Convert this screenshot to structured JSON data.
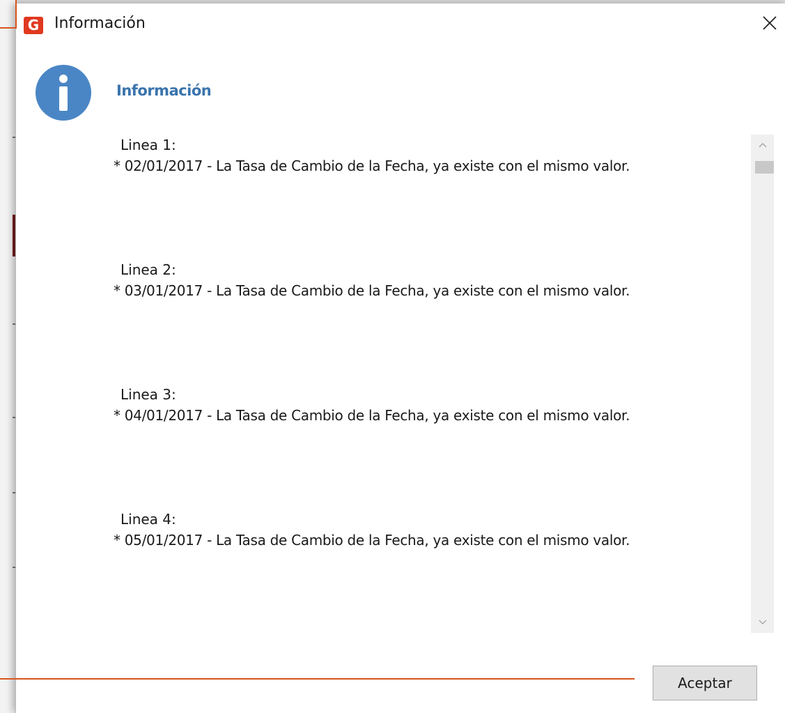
{
  "window": {
    "title": "Información",
    "app_icon_letter": "G",
    "app_icon_name": "app-logo-icon",
    "close_icon": "close-icon"
  },
  "dialog": {
    "heading": "Información",
    "icon": "info-icon",
    "messages": [
      {
        "label": "Linea 1:",
        "detail": "* 02/01/2017 - La Tasa de Cambio de la Fecha, ya existe con el mismo valor."
      },
      {
        "label": "Linea 2:",
        "detail": "* 03/01/2017 - La Tasa de Cambio de la Fecha, ya existe con el mismo valor."
      },
      {
        "label": "Linea 3:",
        "detail": "* 04/01/2017 - La Tasa de Cambio de la Fecha, ya existe con el mismo valor."
      },
      {
        "label": "Linea 4:",
        "detail": "* 05/01/2017 - La Tasa de Cambio de la Fecha, ya existe con el mismo valor."
      }
    ],
    "accept_label": "Aceptar"
  },
  "colors": {
    "accent": "#3a74ad",
    "info_icon": "#4a86c5",
    "app_icon": "#e0391f",
    "annotation": "#d9541e"
  }
}
